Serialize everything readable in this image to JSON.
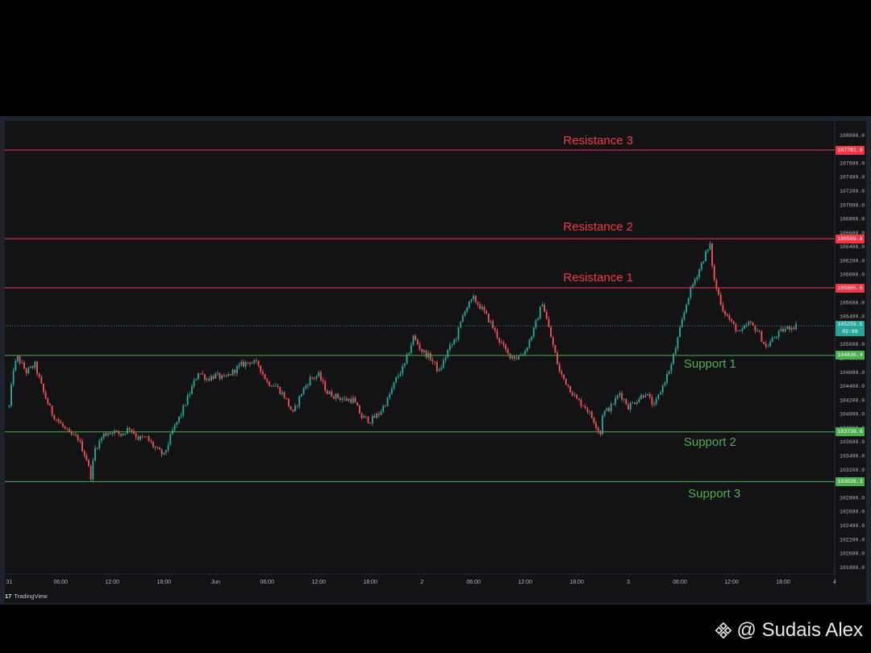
{
  "chart_data": {
    "type": "candlestick",
    "ylim": [
      101700,
      108200
    ],
    "y_ticks": [
      108000,
      107800,
      107600,
      107400,
      107200,
      107000,
      106800,
      106600,
      106400,
      106200,
      106000,
      105800,
      105600,
      105400,
      105200,
      105000,
      104800,
      104600,
      104400,
      104200,
      104000,
      103800,
      103600,
      103400,
      103200,
      103000,
      102800,
      102600,
      102400,
      102200,
      102000,
      101800
    ],
    "x_ticks": [
      {
        "label": "31",
        "t": 0
      },
      {
        "label": "06:00",
        "t": 6
      },
      {
        "label": "12:00",
        "t": 12
      },
      {
        "label": "18:00",
        "t": 18
      },
      {
        "label": "Jun",
        "t": 24
      },
      {
        "label": "06:00",
        "t": 30
      },
      {
        "label": "12:00",
        "t": 36
      },
      {
        "label": "18:00",
        "t": 42
      },
      {
        "label": "2",
        "t": 48
      },
      {
        "label": "06:00",
        "t": 54
      },
      {
        "label": "12:00",
        "t": 60
      },
      {
        "label": "18:00",
        "t": 66
      },
      {
        "label": "3",
        "t": 72
      },
      {
        "label": "06:00",
        "t": 78
      },
      {
        "label": "12:00",
        "t": 84
      },
      {
        "label": "18:00",
        "t": 90
      },
      {
        "label": "4",
        "t": 96
      }
    ],
    "x_range": [
      -0.5,
      96
    ],
    "grid": false,
    "close_path": [
      [
        0,
        104100
      ],
      [
        0.5,
        104650
      ],
      [
        1,
        104800
      ],
      [
        2,
        104600
      ],
      [
        3,
        104700
      ],
      [
        4,
        104300
      ],
      [
        5,
        104000
      ],
      [
        6,
        103850
      ],
      [
        7,
        103700
      ],
      [
        8,
        103650
      ],
      [
        9,
        103350
      ],
      [
        9.5,
        103100
      ],
      [
        10,
        103500
      ],
      [
        11,
        103700
      ],
      [
        12,
        103750
      ],
      [
        13,
        103700
      ],
      [
        14,
        103800
      ],
      [
        15,
        103650
      ],
      [
        16,
        103650
      ],
      [
        17,
        103500
      ],
      [
        18,
        103400
      ],
      [
        19,
        103750
      ],
      [
        20,
        104000
      ],
      [
        21,
        104300
      ],
      [
        22,
        104600
      ],
      [
        23,
        104500
      ],
      [
        24,
        104550
      ],
      [
        25,
        104500
      ],
      [
        26,
        104600
      ],
      [
        27,
        104700
      ],
      [
        28,
        104750
      ],
      [
        29,
        104700
      ],
      [
        30,
        104450
      ],
      [
        31,
        104400
      ],
      [
        32,
        104250
      ],
      [
        33,
        104000
      ],
      [
        34,
        104300
      ],
      [
        35,
        104500
      ],
      [
        36,
        104550
      ],
      [
        37,
        104300
      ],
      [
        38,
        104250
      ],
      [
        39,
        104200
      ],
      [
        40,
        104200
      ],
      [
        41,
        103950
      ],
      [
        42,
        103900
      ],
      [
        43,
        104000
      ],
      [
        44,
        104200
      ],
      [
        45,
        104500
      ],
      [
        46,
        104700
      ],
      [
        47,
        105100
      ],
      [
        47.5,
        105000
      ],
      [
        48,
        104900
      ],
      [
        49,
        104800
      ],
      [
        50,
        104600
      ],
      [
        51,
        104900
      ],
      [
        52,
        105100
      ],
      [
        53,
        105500
      ],
      [
        54,
        105650
      ],
      [
        55,
        105500
      ],
      [
        56,
        105300
      ],
      [
        57,
        105050
      ],
      [
        58,
        104850
      ],
      [
        59,
        104800
      ],
      [
        60,
        104900
      ],
      [
        61,
        105200
      ],
      [
        62,
        105600
      ],
      [
        63,
        105100
      ],
      [
        64,
        104600
      ],
      [
        65,
        104400
      ],
      [
        66,
        104200
      ],
      [
        67,
        104100
      ],
      [
        68,
        103900
      ],
      [
        68.8,
        103700
      ],
      [
        69,
        104000
      ],
      [
        70,
        104100
      ],
      [
        71,
        104300
      ],
      [
        72,
        104100
      ],
      [
        73,
        104200
      ],
      [
        74,
        104300
      ],
      [
        75,
        104100
      ],
      [
        76,
        104400
      ],
      [
        77,
        104700
      ],
      [
        78,
        105200
      ],
      [
        79,
        105700
      ],
      [
        80,
        106000
      ],
      [
        81,
        106300
      ],
      [
        81.5,
        106400
      ],
      [
        82,
        105900
      ],
      [
        83,
        105500
      ],
      [
        84,
        105300
      ],
      [
        85,
        105150
      ],
      [
        86,
        105300
      ],
      [
        87,
        105200
      ],
      [
        88,
        104950
      ],
      [
        89,
        105100
      ],
      [
        90,
        105200
      ],
      [
        91,
        105250
      ],
      [
        91.5,
        105260
      ]
    ],
    "current_price": {
      "value": 105259.5,
      "label": "105259.5",
      "countdown": "02:08"
    },
    "levels": [
      {
        "name": "Resistance 3",
        "value": 107782.9,
        "label": "107782.9",
        "color": "#f23645",
        "label_t": 68.5,
        "label_offset": -11
      },
      {
        "name": "Resistance 2",
        "value": 106509.8,
        "label": "106509.8",
        "color": "#f23645",
        "label_t": 68.5,
        "label_offset": -14
      },
      {
        "name": "Resistance 1",
        "value": 105805.5,
        "label": "105805.5",
        "color": "#f23645",
        "label_t": 68.5,
        "label_offset": -12
      },
      {
        "name": "Support 1",
        "value": 104836.4,
        "label": "104836.4",
        "color": "#4caf50",
        "label_t": 81.5,
        "label_offset": 11
      },
      {
        "name": "Support 2",
        "value": 103738.6,
        "label": "103738.6",
        "color": "#4caf50",
        "label_t": 81.5,
        "label_offset": 13
      },
      {
        "name": "Support 3",
        "value": 103026.3,
        "label": "103026.3",
        "color": "#4caf50",
        "label_t": 82,
        "label_offset": 16
      }
    ],
    "colors": {
      "up": "#26a69a",
      "down": "#ef5350",
      "axis_text": "#b2b5be",
      "background": "#131316"
    }
  },
  "branding": {
    "platform": "TradingView",
    "logo_text": "17"
  },
  "watermark": {
    "text": "@ Sudais Alex"
  }
}
